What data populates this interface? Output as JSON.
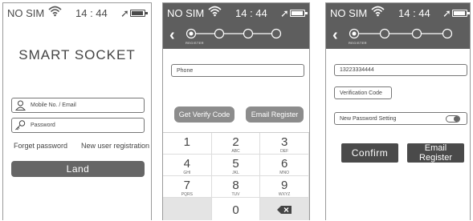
{
  "status": {
    "carrier": "NO SIM",
    "time": "14 : 44",
    "battery_level": 0.8
  },
  "login": {
    "title": "SMART SOCKET",
    "mobile_placeholder": "Mobile No. / Email",
    "password_placeholder": "Password",
    "forget_password": "Forget password",
    "new_user": "New user registration",
    "land_button": "Land"
  },
  "register": {
    "step_label": "REGISTER",
    "phone_placeholder": "Phone",
    "get_code_button": "Get Verify Code",
    "email_register_button": "Email Register",
    "keypad": [
      {
        "digit": "1",
        "letters": ""
      },
      {
        "digit": "2",
        "letters": "ABC"
      },
      {
        "digit": "3",
        "letters": "DEF"
      },
      {
        "digit": "4",
        "letters": "GHI"
      },
      {
        "digit": "5",
        "letters": "JKL"
      },
      {
        "digit": "6",
        "letters": "MNO"
      },
      {
        "digit": "7",
        "letters": "PQRS"
      },
      {
        "digit": "8",
        "letters": "TUV"
      },
      {
        "digit": "9",
        "letters": "WXYZ"
      },
      {
        "digit": "0",
        "letters": ""
      }
    ]
  },
  "verify": {
    "step_label": "REGISTER",
    "phone_value": "13223334444",
    "verification_code": "Verification Code",
    "new_password_setting": "New Password Setting",
    "confirm_button": "Confirm",
    "email_register_button": "Email Register"
  }
}
